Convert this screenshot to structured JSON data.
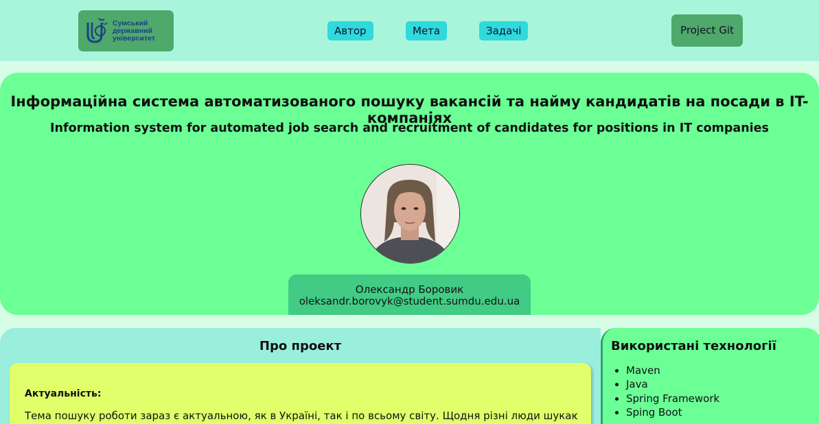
{
  "header": {
    "logo": {
      "text_line1": "Сумський",
      "text_line2": "державний",
      "text_line3": "університет"
    },
    "nav": [
      {
        "label": "Автор"
      },
      {
        "label": "Мета"
      },
      {
        "label": "Задачі"
      }
    ],
    "git_button": "Project Git"
  },
  "hero": {
    "title_ua": "Інформаційна система автоматизованого пошуку вакансій та найму кандидатів на посади в IT-компаніях",
    "title_en": "Information system for automated job search and recruitment of candidates for positions in IT companies",
    "author_name": "Олександр Боровик",
    "author_email": "oleksandr.borovyk@student.sumdu.edu.ua"
  },
  "about": {
    "title": "Про проект",
    "actuality_label": "Актуальність:",
    "actuality_text": "Тема пошуку роботи зараз є актуальною, як в Україні, так і по всьому світу. Щодня різні люди шукають"
  },
  "technologies": {
    "title": "Використані технології",
    "items": [
      "Maven",
      "Java",
      "Spring Framework",
      "Sping Boot"
    ]
  },
  "colors": {
    "header_bg": "#a8f5dc",
    "hero_bg": "#6bff96",
    "nav_button": "#2fd9dc",
    "dark_green_button": "#4fa86c",
    "author_card": "#42cb85",
    "about_bg": "#9aeedc",
    "about_card": "#e0ff6a"
  }
}
